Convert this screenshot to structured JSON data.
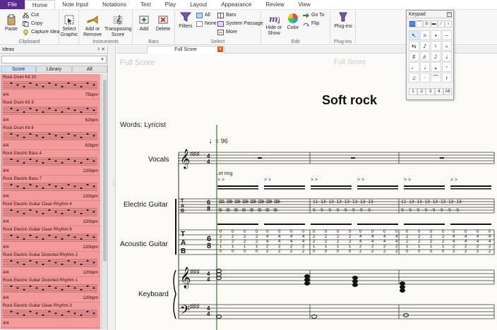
{
  "menubar": {
    "tabs": [
      "File",
      "Home",
      "Note Input",
      "Notations",
      "Text",
      "Play",
      "Layout",
      "Appearance",
      "Review",
      "View"
    ],
    "active": "Home"
  },
  "ribbon": {
    "clipboard": {
      "paste": "Paste",
      "cut": "Cut",
      "copy": "Copy",
      "capture_idea": "Capture Idea",
      "group": "Clipboard"
    },
    "select_graphic": "Select Graphic",
    "instruments": {
      "add_or_remove": "Add or Remove",
      "transposing_score": "Transposing Score",
      "group": "Instruments"
    },
    "bars": {
      "add": "Add",
      "delete": "Delete",
      "group": "Bars"
    },
    "select": {
      "filters": "Filters",
      "all": "All",
      "none": "None",
      "bars": "Bars",
      "system_passage": "System Passage",
      "more": "More",
      "group": "Select"
    },
    "edit": {
      "hide_or_show": "Hide or Show",
      "color": "Color",
      "go_to": "Go To",
      "flip": "Flip",
      "group": "Edit"
    },
    "plugins": {
      "plugins": "Plug-ins",
      "group": "Plug-ins"
    }
  },
  "ideas": {
    "title": "Ideas",
    "controls": "ᵖ ✕",
    "tabs": [
      "Score",
      "Library",
      "All"
    ],
    "items": [
      {
        "name": "Rock Drum Kit 10",
        "time": "4/4",
        "tempo": "75bpm"
      },
      {
        "name": "Rock Drum Kit 9",
        "time": "4/4",
        "tempo": "62bpm"
      },
      {
        "name": "Rock Drum Kit 8",
        "time": "4/4",
        "tempo": "62bpm"
      },
      {
        "name": "Rock Electric Bass 4",
        "time": "4/4",
        "tempo": "120bpm"
      },
      {
        "name": "Rock Electric Bass 7",
        "time": "4/4",
        "tempo": "120bpm"
      },
      {
        "name": "Rock Electric Guitar Clean Rhythm 4",
        "time": "4/4",
        "tempo": "120bpm"
      },
      {
        "name": "Rock Electric Guitar Clean Rhythm 9",
        "time": "4/4",
        "tempo": "120bpm"
      },
      {
        "name": "Rock Electric Guitar Distorted Rhythm 2",
        "time": "4/4",
        "tempo": "120bpm"
      },
      {
        "name": "Rock Electric Guitar Distorted Rhythm 1",
        "time": "4/4",
        "tempo": "120bpm"
      },
      {
        "name": "Rock Electric Guitar Clean Rhythm 3",
        "time": "4/4",
        "tempo": ""
      }
    ]
  },
  "document": {
    "tab": "Full Score",
    "header_left": "Full Score",
    "header_center": "Full Score",
    "title": "Soft rock",
    "lyricist": "Words: Lyricist",
    "tempo": "= 96",
    "technique": "Let ring",
    "instruments": [
      "Vocals",
      "Electric Guitar",
      "Acoustic Guitar",
      "Keyboard"
    ],
    "tab_row1": "11-13-13-13-13-13-13-13-",
    "tab_row2": "9--9--9--9--9--9--9--9-"
  },
  "keypad": {
    "title": "Keypad",
    "top_row": [
      "▭",
      "⁀",
      "⊙",
      "▬",
      "⁄",
      "♭"
    ],
    "grid": [
      "↖",
      ">",
      "•",
      "−",
      "⇆",
      "𝅘𝅥𝅯",
      "♮",
      "♭",
      "♯",
      "♬",
      "𝅘𝅥𝅮",
      "𝅘𝅥",
      "♩",
      "𝅗𝅥",
      "𝅝",
      "𝄾",
      "♫",
      "·",
      "⌒",
      "𝄽"
    ],
    "layers": [
      "1",
      "2",
      "3",
      "4",
      "All"
    ]
  },
  "colors": {
    "file_tab": "#5b2a8c",
    "ideas_bg": "#f49a9a",
    "playline": "#2e7d32"
  }
}
